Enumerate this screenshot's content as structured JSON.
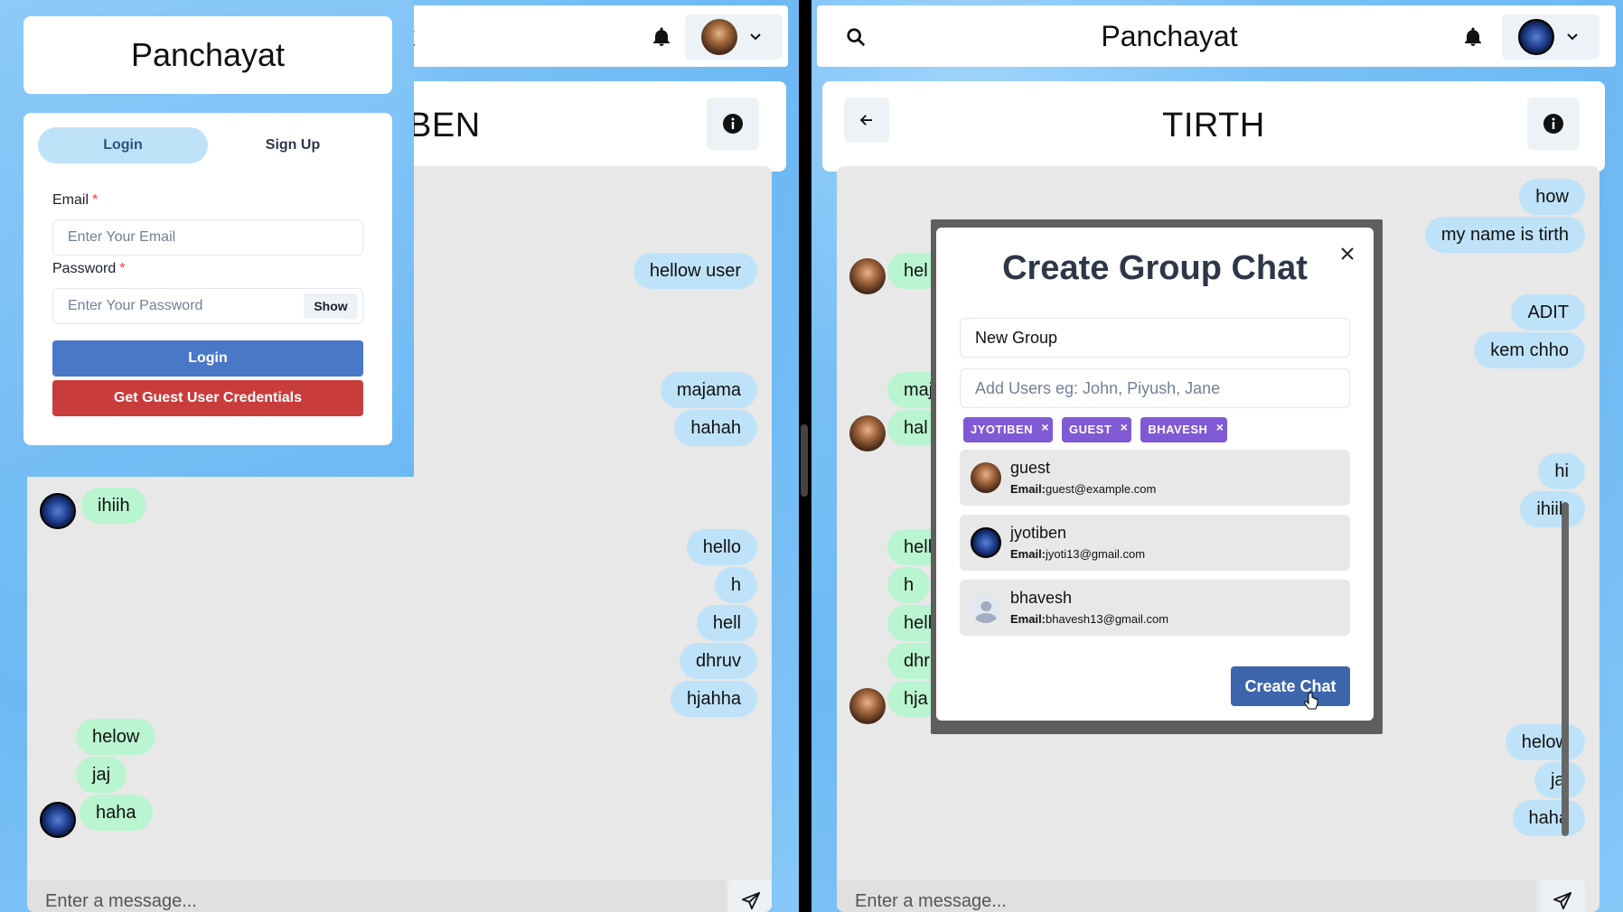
{
  "left_pane": {
    "header_title_fragment": "t",
    "chat_title_fragment": "BEN",
    "messages": [
      {
        "text": "hellow user",
        "side": "me"
      },
      {
        "text": "majama",
        "side": "me"
      },
      {
        "text": "hahah",
        "side": "me"
      },
      {
        "text": "ihiih",
        "side": "them"
      },
      {
        "text": "hello",
        "side": "me"
      },
      {
        "text": "h",
        "side": "me"
      },
      {
        "text": "hell",
        "side": "me"
      },
      {
        "text": "dhruv",
        "side": "me"
      },
      {
        "text": "hjahha",
        "side": "me"
      },
      {
        "text": "helow",
        "side": "them"
      },
      {
        "text": "jaj",
        "side": "them"
      },
      {
        "text": "haha",
        "side": "them"
      }
    ],
    "message_placeholder": "Enter a message..."
  },
  "login": {
    "brand": "Panchayat",
    "tabs": [
      "Login",
      "Sign Up"
    ],
    "active_tab": "Login",
    "email_label": "Email",
    "email_placeholder": "Enter Your Email",
    "password_label": "Password",
    "password_placeholder": "Enter Your Password",
    "show_label": "Show",
    "required_mark": "*",
    "login_button": "Login",
    "guest_button": "Get Guest User Credentials"
  },
  "right_pane": {
    "brand": "Panchayat",
    "chat_title": "TIRTH",
    "messages_me": [
      "how",
      "my name is tirth",
      "ADIT",
      "kem chho",
      "hi",
      "ihiih",
      "helow",
      "jaj",
      "haha"
    ],
    "messages_them_fragments": [
      "hel",
      "maj",
      "hal",
      "hell",
      "h",
      "hell",
      "dhr",
      "hja"
    ],
    "message_placeholder": "Enter a message..."
  },
  "modal": {
    "title": "Create Group Chat",
    "group_name_value": "New Group",
    "add_users_placeholder": "Add Users eg: John, Piyush, Jane",
    "selected_tags": [
      "JYOTIBEN",
      "GUEST",
      "BHAVESH"
    ],
    "tag_remove_glyph": "×",
    "email_prefix": "Email:",
    "users": [
      {
        "name": "guest",
        "email": "guest@example.com",
        "avatar": "brown"
      },
      {
        "name": "jyotiben",
        "email": "jyoti13@gmail.com",
        "avatar": "logo"
      },
      {
        "name": "bhavesh",
        "email": "bhavesh13@gmail.com",
        "avatar": "grey"
      }
    ],
    "create_button": "Create Chat"
  },
  "colors": {
    "my_bubble": "#bee3f8",
    "their_bubble": "#b9f5d0",
    "login_blue": "#4a78c8",
    "guest_red": "#c93c3c",
    "tag_purple": "#805ad5",
    "create_button": "#3d65ab"
  }
}
